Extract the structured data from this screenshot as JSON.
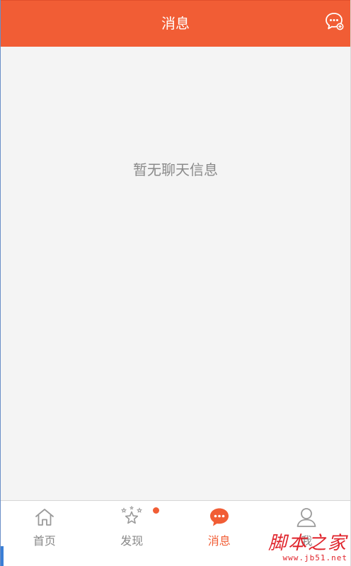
{
  "header": {
    "title": "消息",
    "action_icon": "chat-add-icon"
  },
  "content": {
    "empty_message": "暂无聊天信息"
  },
  "tabbar": {
    "tabs": [
      {
        "label": "首页",
        "icon": "home-icon",
        "active": false
      },
      {
        "label": "发现",
        "icon": "star-discover-icon",
        "active": false,
        "badge": "dot"
      },
      {
        "label": "消息",
        "icon": "chat-bubble-icon",
        "active": true
      },
      {
        "label": "我",
        "icon": "user-icon",
        "active": false
      }
    ]
  },
  "watermark": {
    "main": "脚本之家",
    "sub": "www.jb51.net"
  },
  "colors": {
    "accent": "#f15d35",
    "background": "#f4f4f4",
    "inactive_text": "#888888",
    "watermark": "#e0242c"
  }
}
